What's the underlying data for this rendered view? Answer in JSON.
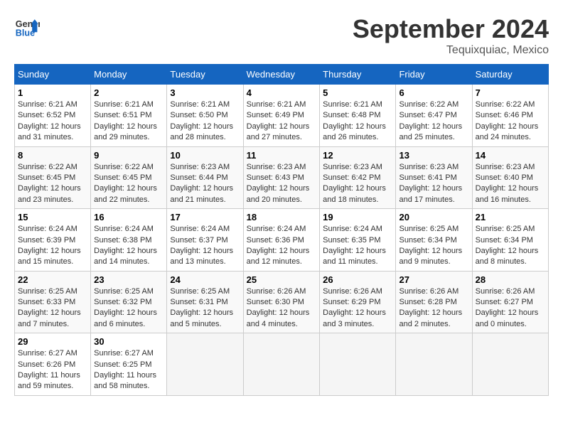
{
  "header": {
    "logo_line1": "General",
    "logo_line2": "Blue",
    "month": "September 2024",
    "location": "Tequixquiac, Mexico"
  },
  "weekdays": [
    "Sunday",
    "Monday",
    "Tuesday",
    "Wednesday",
    "Thursday",
    "Friday",
    "Saturday"
  ],
  "weeks": [
    [
      {
        "day": "1",
        "info": "Sunrise: 6:21 AM\nSunset: 6:52 PM\nDaylight: 12 hours\nand 31 minutes."
      },
      {
        "day": "2",
        "info": "Sunrise: 6:21 AM\nSunset: 6:51 PM\nDaylight: 12 hours\nand 29 minutes."
      },
      {
        "day": "3",
        "info": "Sunrise: 6:21 AM\nSunset: 6:50 PM\nDaylight: 12 hours\nand 28 minutes."
      },
      {
        "day": "4",
        "info": "Sunrise: 6:21 AM\nSunset: 6:49 PM\nDaylight: 12 hours\nand 27 minutes."
      },
      {
        "day": "5",
        "info": "Sunrise: 6:21 AM\nSunset: 6:48 PM\nDaylight: 12 hours\nand 26 minutes."
      },
      {
        "day": "6",
        "info": "Sunrise: 6:22 AM\nSunset: 6:47 PM\nDaylight: 12 hours\nand 25 minutes."
      },
      {
        "day": "7",
        "info": "Sunrise: 6:22 AM\nSunset: 6:46 PM\nDaylight: 12 hours\nand 24 minutes."
      }
    ],
    [
      {
        "day": "8",
        "info": "Sunrise: 6:22 AM\nSunset: 6:45 PM\nDaylight: 12 hours\nand 23 minutes."
      },
      {
        "day": "9",
        "info": "Sunrise: 6:22 AM\nSunset: 6:45 PM\nDaylight: 12 hours\nand 22 minutes."
      },
      {
        "day": "10",
        "info": "Sunrise: 6:23 AM\nSunset: 6:44 PM\nDaylight: 12 hours\nand 21 minutes."
      },
      {
        "day": "11",
        "info": "Sunrise: 6:23 AM\nSunset: 6:43 PM\nDaylight: 12 hours\nand 20 minutes."
      },
      {
        "day": "12",
        "info": "Sunrise: 6:23 AM\nSunset: 6:42 PM\nDaylight: 12 hours\nand 18 minutes."
      },
      {
        "day": "13",
        "info": "Sunrise: 6:23 AM\nSunset: 6:41 PM\nDaylight: 12 hours\nand 17 minutes."
      },
      {
        "day": "14",
        "info": "Sunrise: 6:23 AM\nSunset: 6:40 PM\nDaylight: 12 hours\nand 16 minutes."
      }
    ],
    [
      {
        "day": "15",
        "info": "Sunrise: 6:24 AM\nSunset: 6:39 PM\nDaylight: 12 hours\nand 15 minutes."
      },
      {
        "day": "16",
        "info": "Sunrise: 6:24 AM\nSunset: 6:38 PM\nDaylight: 12 hours\nand 14 minutes."
      },
      {
        "day": "17",
        "info": "Sunrise: 6:24 AM\nSunset: 6:37 PM\nDaylight: 12 hours\nand 13 minutes."
      },
      {
        "day": "18",
        "info": "Sunrise: 6:24 AM\nSunset: 6:36 PM\nDaylight: 12 hours\nand 12 minutes."
      },
      {
        "day": "19",
        "info": "Sunrise: 6:24 AM\nSunset: 6:35 PM\nDaylight: 12 hours\nand 11 minutes."
      },
      {
        "day": "20",
        "info": "Sunrise: 6:25 AM\nSunset: 6:34 PM\nDaylight: 12 hours\nand 9 minutes."
      },
      {
        "day": "21",
        "info": "Sunrise: 6:25 AM\nSunset: 6:34 PM\nDaylight: 12 hours\nand 8 minutes."
      }
    ],
    [
      {
        "day": "22",
        "info": "Sunrise: 6:25 AM\nSunset: 6:33 PM\nDaylight: 12 hours\nand 7 minutes."
      },
      {
        "day": "23",
        "info": "Sunrise: 6:25 AM\nSunset: 6:32 PM\nDaylight: 12 hours\nand 6 minutes."
      },
      {
        "day": "24",
        "info": "Sunrise: 6:25 AM\nSunset: 6:31 PM\nDaylight: 12 hours\nand 5 minutes."
      },
      {
        "day": "25",
        "info": "Sunrise: 6:26 AM\nSunset: 6:30 PM\nDaylight: 12 hours\nand 4 minutes."
      },
      {
        "day": "26",
        "info": "Sunrise: 6:26 AM\nSunset: 6:29 PM\nDaylight: 12 hours\nand 3 minutes."
      },
      {
        "day": "27",
        "info": "Sunrise: 6:26 AM\nSunset: 6:28 PM\nDaylight: 12 hours\nand 2 minutes."
      },
      {
        "day": "28",
        "info": "Sunrise: 6:26 AM\nSunset: 6:27 PM\nDaylight: 12 hours\nand 0 minutes."
      }
    ],
    [
      {
        "day": "29",
        "info": "Sunrise: 6:27 AM\nSunset: 6:26 PM\nDaylight: 11 hours\nand 59 minutes."
      },
      {
        "day": "30",
        "info": "Sunrise: 6:27 AM\nSunset: 6:25 PM\nDaylight: 11 hours\nand 58 minutes."
      },
      {
        "day": "",
        "info": ""
      },
      {
        "day": "",
        "info": ""
      },
      {
        "day": "",
        "info": ""
      },
      {
        "day": "",
        "info": ""
      },
      {
        "day": "",
        "info": ""
      }
    ]
  ]
}
